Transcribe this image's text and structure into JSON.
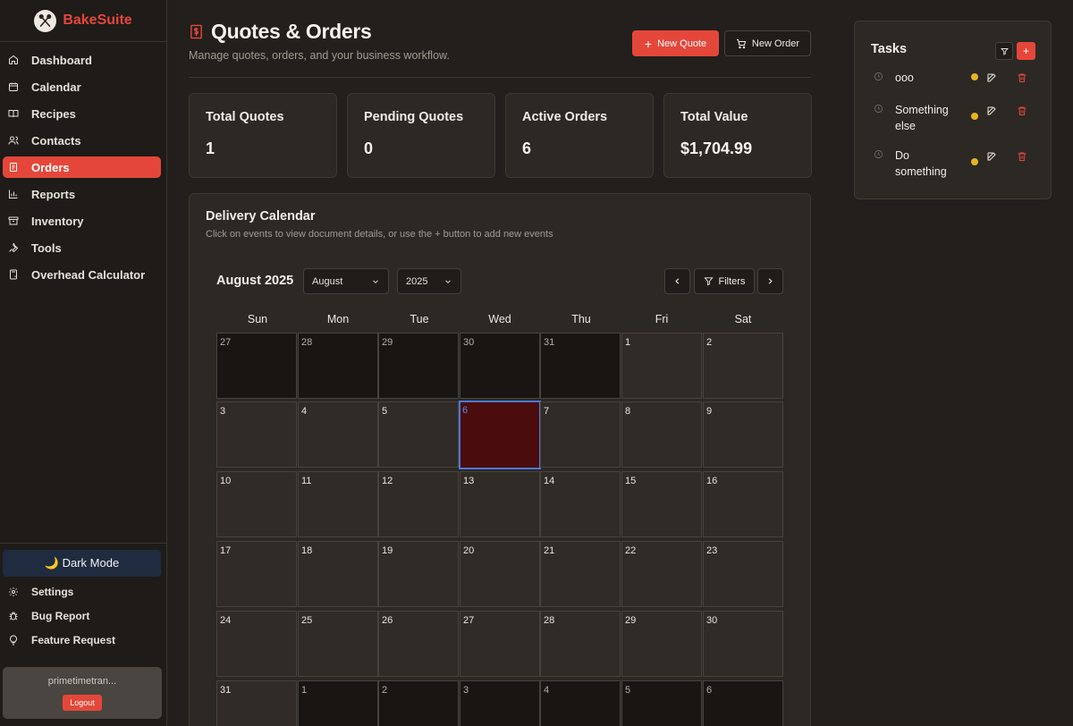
{
  "brand": {
    "name": "BakeSuite"
  },
  "sidebar": {
    "items": [
      {
        "label": "Dashboard",
        "icon": "home-icon"
      },
      {
        "label": "Calendar",
        "icon": "calendar-icon"
      },
      {
        "label": "Recipes",
        "icon": "book-icon"
      },
      {
        "label": "Contacts",
        "icon": "users-icon"
      },
      {
        "label": "Orders",
        "icon": "receipt-icon",
        "active": true
      },
      {
        "label": "Reports",
        "icon": "bar-chart-icon"
      },
      {
        "label": "Inventory",
        "icon": "archive-icon"
      },
      {
        "label": "Tools",
        "icon": "wrench-icon"
      },
      {
        "label": "Overhead Calculator",
        "icon": "calculator-icon"
      }
    ],
    "dark_mode_label": "🌙 Dark Mode",
    "utility": [
      {
        "label": "Settings",
        "icon": "gear-icon"
      },
      {
        "label": "Bug Report",
        "icon": "bug-icon"
      },
      {
        "label": "Feature Request",
        "icon": "lightbulb-icon"
      }
    ],
    "user": {
      "name": "primetimetran...",
      "logout_label": "Logout"
    }
  },
  "header": {
    "title": "Quotes & Orders",
    "subtitle": "Manage quotes, orders, and your business workflow.",
    "new_quote_label": "New Quote",
    "new_order_label": "New Order"
  },
  "stats": [
    {
      "label": "Total Quotes",
      "value": "1"
    },
    {
      "label": "Pending Quotes",
      "value": "0"
    },
    {
      "label": "Active Orders",
      "value": "6"
    },
    {
      "label": "Total Value",
      "value": "$1,704.99"
    }
  ],
  "calendar": {
    "title": "Delivery Calendar",
    "description": "Click on events to view document details, or use the + button to add new events",
    "month_heading": "August 2025",
    "month_select": "August",
    "year_select": "2025",
    "filters_label": "Filters",
    "weekdays": [
      "Sun",
      "Mon",
      "Tue",
      "Wed",
      "Thu",
      "Fri",
      "Sat"
    ],
    "weeks": [
      [
        "27",
        "28",
        "29",
        "30",
        "31",
        "1",
        "2"
      ],
      [
        "3",
        "4",
        "5",
        "6",
        "7",
        "8",
        "9"
      ],
      [
        "10",
        "11",
        "12",
        "13",
        "14",
        "15",
        "16"
      ],
      [
        "17",
        "18",
        "19",
        "20",
        "21",
        "22",
        "23"
      ],
      [
        "24",
        "25",
        "26",
        "27",
        "28",
        "29",
        "30"
      ],
      [
        "31",
        "1",
        "2",
        "3",
        "4",
        "5",
        "6"
      ]
    ],
    "today": "6"
  },
  "tasks": {
    "title": "Tasks",
    "add_label": "+",
    "items": [
      {
        "text": "ooo"
      },
      {
        "text": "Something else"
      },
      {
        "text": "Do something"
      }
    ]
  },
  "colors": {
    "accent": "#e4473a",
    "background": "#221f1c",
    "card": "#2c2824",
    "today_bg": "#4a0c0c",
    "today_border": "#4a78d8",
    "task_dot": "#e7b421"
  }
}
